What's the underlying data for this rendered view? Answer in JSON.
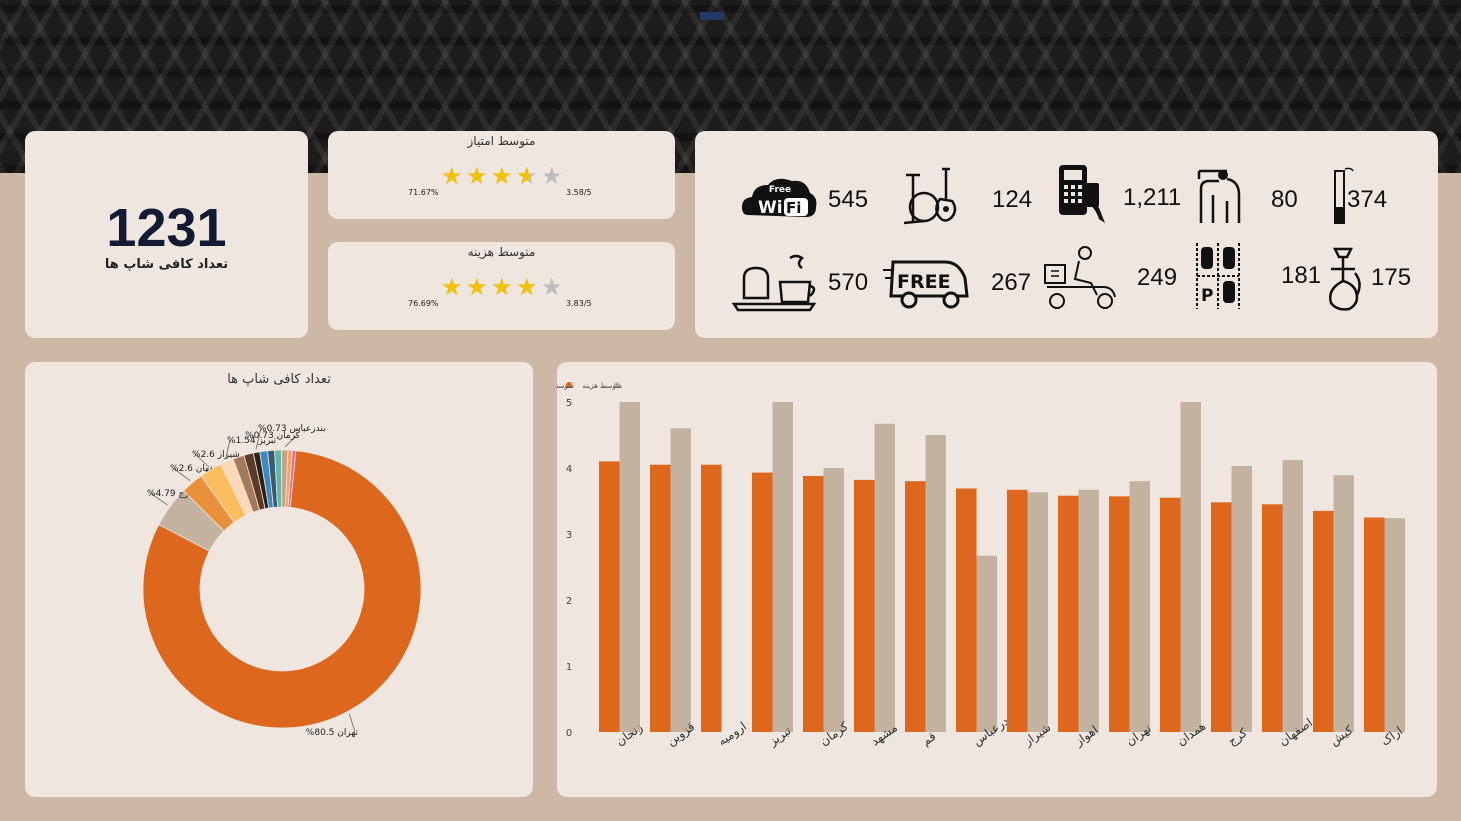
{
  "summary": {
    "cafe_count": "1231",
    "cafe_count_label": "تعداد کافی شاپ ها"
  },
  "ratings": {
    "score": {
      "title": "متوسط امتیاز",
      "percent": "71.67%",
      "ratio": "3.58/5",
      "stars": 3.58
    },
    "cost": {
      "title": "متوسط هزینه",
      "percent": "76.69%",
      "ratio": "3.83/5",
      "stars": 3.83
    }
  },
  "amenities": [
    {
      "icon": "free-wifi-icon",
      "value": "545"
    },
    {
      "icon": "live-music-icon",
      "value": "124"
    },
    {
      "icon": "card-payment-icon",
      "value": "1,211"
    },
    {
      "icon": "disabled-access-icon",
      "value": "80"
    },
    {
      "icon": "smoking-icon",
      "value": "374"
    },
    {
      "icon": "breakfast-icon",
      "value": "570"
    },
    {
      "icon": "free-delivery-icon",
      "value": "267"
    },
    {
      "icon": "delivery-scooter-icon",
      "value": "249"
    },
    {
      "icon": "parking-icon",
      "value": "181"
    },
    {
      "icon": "hookah-icon",
      "value": "175"
    }
  ],
  "colors": {
    "accent": "#dd671c",
    "secondary": "#c3b2a0",
    "page": "#cdb8a6",
    "card": "#efe6df",
    "star": "#f2c200",
    "hero": "#1e1c1b"
  },
  "chart_data": [
    {
      "type": "pie",
      "title": "تعداد کافی شاپ ها",
      "donut": true,
      "slices": [
        {
          "label": "تهران",
          "value": 80.5,
          "label_text": "تهران 80.5%",
          "color": "#dd671c"
        },
        {
          "label": "کرج",
          "value": 4.79,
          "label_text": "کرج 4.79%",
          "color": "#c3b2a0"
        },
        {
          "label": "اصفهان",
          "value": 2.6,
          "label_text": "اصفهان 2.6%",
          "color": "#e8913a"
        },
        {
          "label": "شیراز",
          "value": 2.6,
          "label_text": "شیراز 2.6%",
          "color": "#fbbd5e"
        },
        {
          "label": "تبریز",
          "value": 1.54,
          "label_text": "تبریز 1.54%",
          "color": "#fed8b8"
        },
        {
          "label": "",
          "value": 1.3,
          "label_text": "",
          "color": "#a57a5a"
        },
        {
          "label": "",
          "value": 1.1,
          "label_text": "",
          "color": "#5b3a26"
        },
        {
          "label": "بندرعباس",
          "value": 0.73,
          "label_text": "بندرعباس 0.73%",
          "color": "#2e1f17"
        },
        {
          "label": "",
          "value": 0.9,
          "label_text": "",
          "color": "#3b8bc2"
        },
        {
          "label": "",
          "value": 0.8,
          "label_text": "",
          "color": "#3c5a6e"
        },
        {
          "label": "",
          "value": 0.8,
          "label_text": "",
          "color": "#5fb8ad"
        },
        {
          "label": "کرمان",
          "value": 0.73,
          "label_text": "کرمان 0.73%",
          "color": "#c4a484"
        },
        {
          "label": "",
          "value": 0.5,
          "label_text": "",
          "color": "#f5a45b"
        },
        {
          "label": "",
          "value": 0.4,
          "label_text": "",
          "color": "#e36a9a"
        }
      ]
    },
    {
      "type": "bar",
      "categories": [
        "زنجان",
        "قزوین",
        "ارومیه",
        "تبریز",
        "کرمان",
        "مشهد",
        "قم",
        "بندرعباس",
        "شیراز",
        "اهواز",
        "تهران",
        "همدان",
        "کرج",
        "اصفهان",
        "کیش",
        "اراک"
      ],
      "series": [
        {
          "name": "متوسط امتیاز",
          "color": "#dd671c",
          "values": [
            4.1,
            4.05,
            4.05,
            3.93,
            3.88,
            3.82,
            3.8,
            3.69,
            3.67,
            3.58,
            3.57,
            3.55,
            3.48,
            3.45,
            3.35,
            3.25
          ]
        },
        {
          "name": "متوسط هزینه",
          "color": "#c3b2a0",
          "values": [
            5.0,
            4.6,
            null,
            5.0,
            4.0,
            4.67,
            4.5,
            2.67,
            3.63,
            3.67,
            3.8,
            5.0,
            4.03,
            4.12,
            3.89,
            3.24
          ]
        }
      ],
      "ylim": [
        0,
        5
      ],
      "yticks": [
        "0",
        "1",
        "2",
        "3",
        "4",
        "5"
      ],
      "legend_position": "top-left",
      "grid": false
    }
  ]
}
